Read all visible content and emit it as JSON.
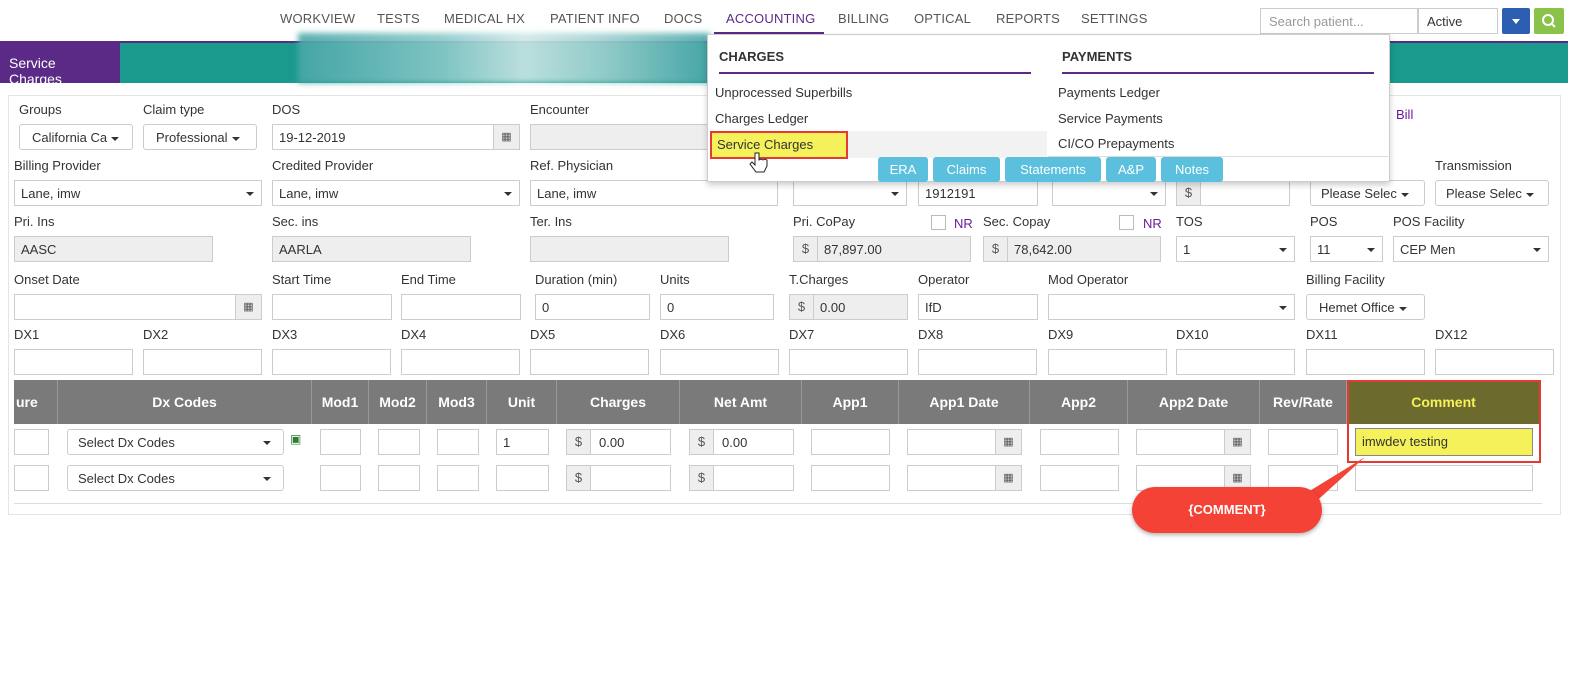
{
  "nav": {
    "items": [
      "WORKVIEW",
      "TESTS",
      "MEDICAL HX",
      "PATIENT INFO",
      "DOCS",
      "ACCOUNTING",
      "BILLING",
      "OPTICAL",
      "REPORTS",
      "SETTINGS"
    ],
    "active": "ACCOUNTING",
    "search_placeholder": "Search patient...",
    "status": "Active"
  },
  "section_title": "Service Charges",
  "form": {
    "groups": {
      "label": "Groups",
      "value": "California Ca"
    },
    "claim_type": {
      "label": "Claim type",
      "value": "Professional"
    },
    "dos": {
      "label": "DOS",
      "value": "19-12-2019"
    },
    "encounter": {
      "label": "Encounter",
      "value": ""
    },
    "bill_link": "Bill",
    "billing_provider": {
      "label": "Billing Provider",
      "value": "Lane, imw"
    },
    "credited_provider": {
      "label": "Credited Provider",
      "value": "Lane, imw"
    },
    "ref_physician": {
      "label": "Ref. Physician",
      "value": "Lane, imw"
    },
    "hidden_field_value": "1912191",
    "transmission": {
      "label": "Transmission",
      "value": "Please Selec"
    },
    "please_select_left": "Please Selec",
    "pri_ins": {
      "label": "Pri. Ins",
      "value": "AASC"
    },
    "sec_ins": {
      "label": "Sec. ins",
      "value": "AARLA"
    },
    "ter_ins": {
      "label": "Ter. Ins",
      "value": ""
    },
    "pri_copay": {
      "label": "Pri. CoPay",
      "value": "87,897.00",
      "nr": "NR"
    },
    "sec_copay": {
      "label": "Sec. Copay",
      "value": "78,642.00",
      "nr": "NR"
    },
    "tos": {
      "label": "TOS",
      "value": "1"
    },
    "pos": {
      "label": "POS",
      "value": "11"
    },
    "pos_facility": {
      "label": "POS Facility",
      "value": "CEP Men"
    },
    "onset_date": {
      "label": "Onset Date",
      "value": ""
    },
    "start_time": {
      "label": "Start Time",
      "value": ""
    },
    "end_time": {
      "label": "End Time",
      "value": ""
    },
    "duration": {
      "label": "Duration (min)",
      "value": "0"
    },
    "units": {
      "label": "Units",
      "value": "0"
    },
    "t_charges": {
      "label": "T.Charges",
      "value": "0.00"
    },
    "operator": {
      "label": "Operator",
      "value": "IfD"
    },
    "mod_operator": {
      "label": "Mod Operator",
      "value": ""
    },
    "billing_facility": {
      "label": "Billing Facility",
      "value": "Hemet Office"
    },
    "currency": "$",
    "dx_labels": [
      "DX1",
      "DX2",
      "DX3",
      "DX4",
      "DX5",
      "DX6",
      "DX7",
      "DX8",
      "DX9",
      "DX10",
      "DX11",
      "DX12"
    ]
  },
  "grid": {
    "headers": [
      "ure",
      "Dx Codes",
      "Mod1",
      "Mod2",
      "Mod3",
      "Unit",
      "Charges",
      "Net Amt",
      "App1",
      "App1 Date",
      "App2",
      "App2 Date",
      "Rev/Rate",
      "Comment"
    ],
    "rows": [
      {
        "dx": "Select Dx Codes",
        "unit": "1",
        "charges": "0.00",
        "net": "0.00",
        "comment": "imwdev testing"
      },
      {
        "dx": "Select Dx Codes",
        "unit": "",
        "charges": "",
        "net": "",
        "comment": ""
      }
    ]
  },
  "accounting_menu": {
    "charges_header": "CHARGES",
    "payments_header": "PAYMENTS",
    "charges_items": [
      "Unprocessed Superbills",
      "Charges Ledger",
      "Service Charges"
    ],
    "payments_items": [
      "Payments Ledger",
      "Service Payments",
      "CI/CO Prepayments"
    ],
    "pills": [
      "ERA",
      "Claims",
      "Statements",
      "A&P",
      "Notes"
    ]
  },
  "callout": "{COMMENT}",
  "colors": {
    "purple": "#5b2a86",
    "teal": "#1a9a8c",
    "highlight": "#f4f15a",
    "annotation_red": "#f44336"
  }
}
